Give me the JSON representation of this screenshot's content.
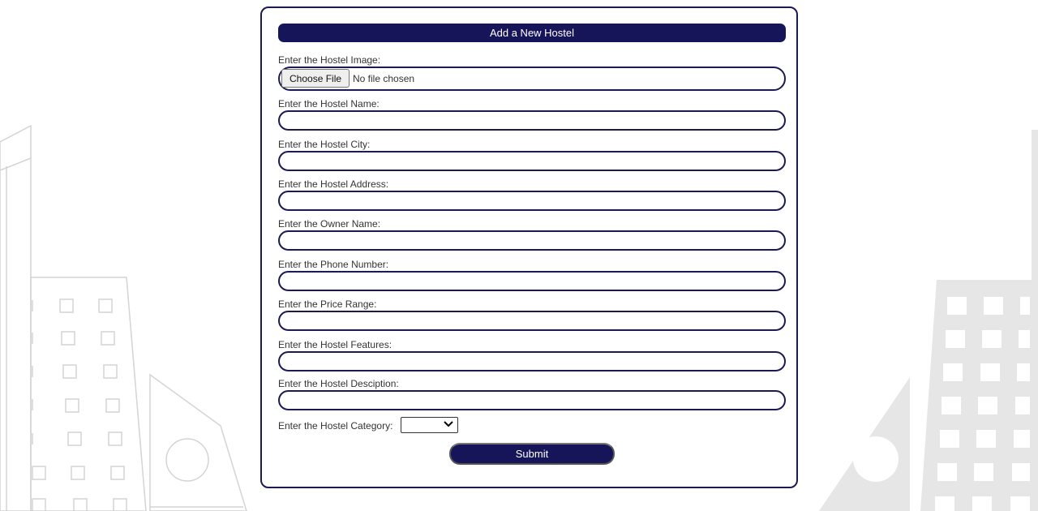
{
  "form": {
    "title": "Add a New Hostel",
    "fields": [
      {
        "label": "Enter the Hostel Image:",
        "type": "file",
        "button_label": "Choose File",
        "status": "No file chosen"
      },
      {
        "label": "Enter the Hostel Name:",
        "value": ""
      },
      {
        "label": "Enter the Hostel City:",
        "value": ""
      },
      {
        "label": "Enter the Hostel Address:",
        "value": ""
      },
      {
        "label": "Enter the Owner Name:",
        "value": ""
      },
      {
        "label": "Enter the Phone Number:",
        "value": ""
      },
      {
        "label": "Enter the Price Range:",
        "value": ""
      },
      {
        "label": "Enter the Hostel Features:",
        "value": ""
      },
      {
        "label": "Enter the Hostel Desciption:",
        "value": ""
      }
    ],
    "category": {
      "label": "Enter the Hostel Category:",
      "selected": "",
      "icon": "chevron-down-icon"
    },
    "submit_label": "Submit"
  },
  "colors": {
    "accent": "#17155a",
    "border": "#1c1a55",
    "background_buildings": "#e6e6e6"
  }
}
